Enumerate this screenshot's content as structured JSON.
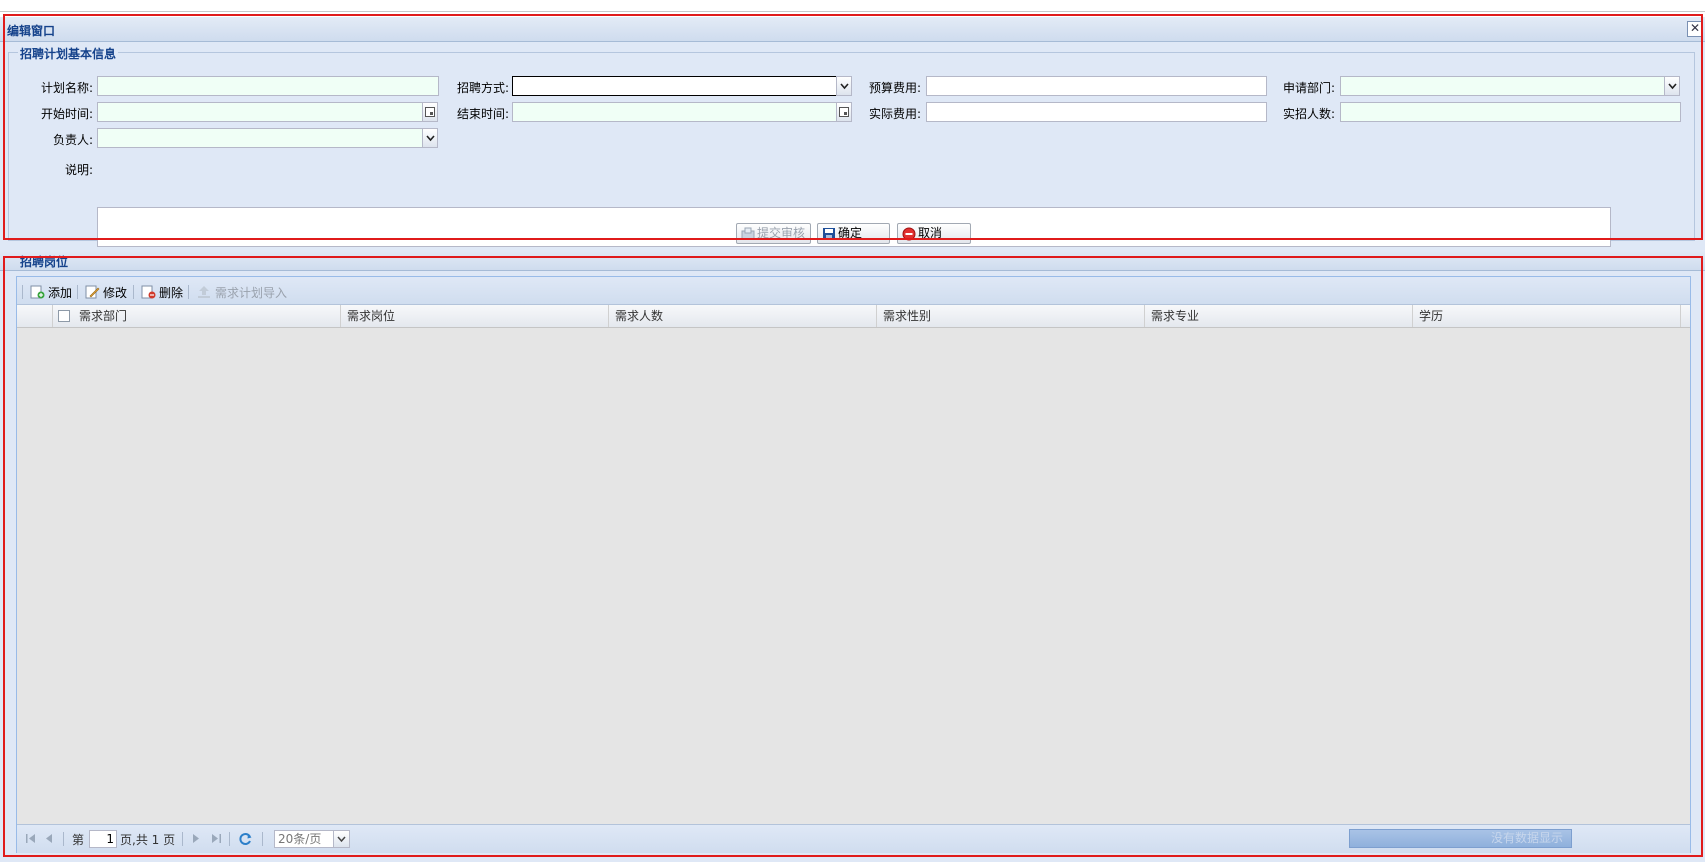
{
  "window": {
    "title": "编辑窗口",
    "close_glyph": "✕"
  },
  "basic_info": {
    "legend": "招聘计划基本信息",
    "labels": {
      "plan_name": "计划名称:",
      "recruit_method": "招聘方式:",
      "budget_cost": "预算费用:",
      "apply_dept": "申请部门:",
      "start_time": "开始时间:",
      "end_time": "结束时间:",
      "actual_cost": "实际费用:",
      "actual_hires": "实招人数:",
      "owner": "负责人:",
      "description": "说明:"
    },
    "values": {
      "plan_name": "",
      "recruit_method": "",
      "budget_cost": "",
      "apply_dept": "",
      "start_time": "",
      "end_time": "",
      "actual_cost": "",
      "actual_hires": "",
      "owner": "",
      "description": ""
    },
    "buttons": {
      "submit_review": "提交审核",
      "confirm": "确定",
      "cancel": "取消"
    }
  },
  "positions": {
    "title": "招聘岗位",
    "toolbar": {
      "add": "添加",
      "edit": "修改",
      "delete": "删除",
      "import": "需求计划导入"
    },
    "columns": [
      "需求部门",
      "需求岗位",
      "需求人数",
      "需求性别",
      "需求专业",
      "学历"
    ],
    "rows": [],
    "pager": {
      "page_prefix": "第",
      "current_page": "1",
      "page_suffix": "页,共 1 页",
      "page_size": "20条/页",
      "empty_message": "没有数据显示"
    }
  },
  "colors": {
    "highlight": "#e01b1b",
    "title_blue": "#15428b",
    "required_field": "#f0fff6"
  }
}
